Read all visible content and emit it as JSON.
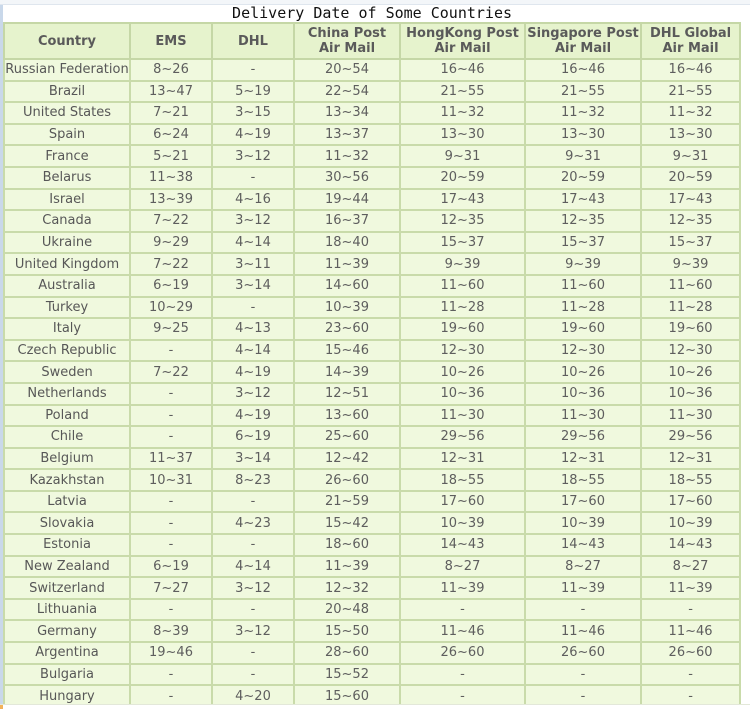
{
  "title": "Delivery Date of Some Countries",
  "columns": [
    {
      "line1": "Country",
      "line2": ""
    },
    {
      "line1": "EMS",
      "line2": ""
    },
    {
      "line1": "DHL",
      "line2": ""
    },
    {
      "line1": "China Post",
      "line2": "Air Mail"
    },
    {
      "line1": "HongKong Post",
      "line2": "Air Mail"
    },
    {
      "line1": "Singapore Post",
      "line2": "Air Mail"
    },
    {
      "line1": "DHL Global",
      "line2": "Air Mail"
    }
  ],
  "rows": [
    [
      "Russian Federation",
      "8~26",
      "-",
      "20~54",
      "16~46",
      "16~46",
      "16~46"
    ],
    [
      "Brazil",
      "13~47",
      "5~19",
      "22~54",
      "21~55",
      "21~55",
      "21~55"
    ],
    [
      "United States",
      "7~21",
      "3~15",
      "13~34",
      "11~32",
      "11~32",
      "11~32"
    ],
    [
      "Spain",
      "6~24",
      "4~19",
      "13~37",
      "13~30",
      "13~30",
      "13~30"
    ],
    [
      "France",
      "5~21",
      "3~12",
      "11~32",
      "9~31",
      "9~31",
      "9~31"
    ],
    [
      "Belarus",
      "11~38",
      "-",
      "30~56",
      "20~59",
      "20~59",
      "20~59"
    ],
    [
      "Israel",
      "13~39",
      "4~16",
      "19~44",
      "17~43",
      "17~43",
      "17~43"
    ],
    [
      "Canada",
      "7~22",
      "3~12",
      "16~37",
      "12~35",
      "12~35",
      "12~35"
    ],
    [
      "Ukraine",
      "9~29",
      "4~14",
      "18~40",
      "15~37",
      "15~37",
      "15~37"
    ],
    [
      "United Kingdom",
      "7~22",
      "3~11",
      "11~39",
      "9~39",
      "9~39",
      "9~39"
    ],
    [
      "Australia",
      "6~19",
      "3~14",
      "14~60",
      "11~60",
      "11~60",
      "11~60"
    ],
    [
      "Turkey",
      "10~29",
      "-",
      "10~39",
      "11~28",
      "11~28",
      "11~28"
    ],
    [
      "Italy",
      "9~25",
      "4~13",
      "23~60",
      "19~60",
      "19~60",
      "19~60"
    ],
    [
      "Czech Republic",
      "-",
      "4~14",
      "15~46",
      "12~30",
      "12~30",
      "12~30"
    ],
    [
      "Sweden",
      "7~22",
      "4~19",
      "14~39",
      "10~26",
      "10~26",
      "10~26"
    ],
    [
      "Netherlands",
      "-",
      "3~12",
      "12~51",
      "10~36",
      "10~36",
      "10~36"
    ],
    [
      "Poland",
      "-",
      "4~19",
      "13~60",
      "11~30",
      "11~30",
      "11~30"
    ],
    [
      "Chile",
      "-",
      "6~19",
      "25~60",
      "29~56",
      "29~56",
      "29~56"
    ],
    [
      "Belgium",
      "11~37",
      "3~14",
      "12~42",
      "12~31",
      "12~31",
      "12~31"
    ],
    [
      "Kazakhstan",
      "10~31",
      "8~23",
      "26~60",
      "18~55",
      "18~55",
      "18~55"
    ],
    [
      "Latvia",
      "-",
      "-",
      "21~59",
      "17~60",
      "17~60",
      "17~60"
    ],
    [
      "Slovakia",
      "-",
      "4~23",
      "15~42",
      "10~39",
      "10~39",
      "10~39"
    ],
    [
      "Estonia",
      "-",
      "-",
      "18~60",
      "14~43",
      "14~43",
      "14~43"
    ],
    [
      "New Zealand",
      "6~19",
      "4~14",
      "11~39",
      "8~27",
      "8~27",
      "8~27"
    ],
    [
      "Switzerland",
      "7~27",
      "3~12",
      "12~32",
      "11~39",
      "11~39",
      "11~39"
    ],
    [
      "Lithuania",
      "-",
      "-",
      "20~48",
      "-",
      "-",
      "-"
    ],
    [
      "Germany",
      "8~39",
      "3~12",
      "15~50",
      "11~46",
      "11~46",
      "11~46"
    ],
    [
      "Argentina",
      "19~46",
      "-",
      "28~60",
      "26~60",
      "26~60",
      "26~60"
    ],
    [
      "Bulgaria",
      "-",
      "-",
      "15~52",
      "-",
      "-",
      "-"
    ],
    [
      "Hungary",
      "-",
      "4~20",
      "15~60",
      "-",
      "-",
      "-"
    ]
  ]
}
